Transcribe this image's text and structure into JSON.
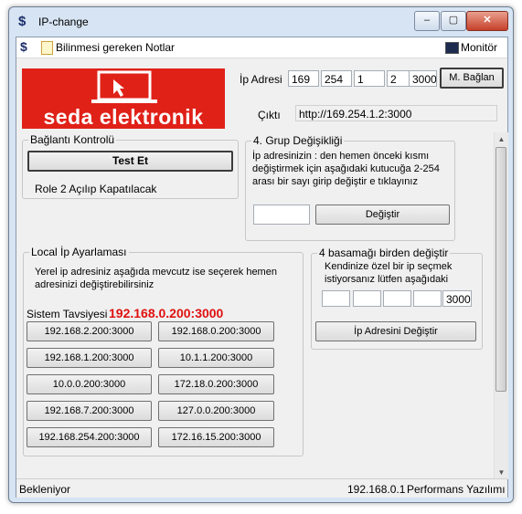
{
  "window": {
    "title": "IP-change"
  },
  "menu": {
    "notes": "Bilinmesi gereken Notlar",
    "monitor": "Monitör"
  },
  "logo": {
    "brand": "seda elektronik"
  },
  "ip": {
    "label": "İp Adresi",
    "octet1": "169",
    "octet2": "254",
    "octet3": "1",
    "octet4": "2",
    "port": "3000",
    "connect_button": "M. Bağlan",
    "output_label": "Çıktı",
    "output_value": "http://169.254.1.2:3000"
  },
  "connection_group": {
    "title": "Bağlantı Kontrolü",
    "test_button": "Test Et",
    "info": "Role 2 Açılıp Kapatılacak"
  },
  "group4": {
    "title": "4. Grup Değişikliği",
    "description": [
      "İp adresinizin : den hemen önceki kısmı",
      "değiştirmek için aşağıdaki kutucuğa 2-254",
      "arası bir sayı girip değiştir e tıklayınız"
    ],
    "input_value": "",
    "change_button": "Değiştir"
  },
  "local_ip": {
    "title": "Local İp Ayarlaması",
    "description": [
      "Yerel ip adresiniz aşağıda mevcutz ise seçerek hemen",
      "adresinizi değiştirebilirsiniz"
    ],
    "recommendation_label": "Sistem Tavsiyesi",
    "recommendation_value": "192.168.0.200:3000",
    "addresses": [
      "192.168.2.200:3000",
      "192.168.0.200:3000",
      "192.168.1.200:3000",
      "10.1.1.200:3000",
      "10.0.0.200:3000",
      "172.18.0.200:3000",
      "192.168.7.200:3000",
      "127.0.0.200:3000",
      "192.168.254.200:3000",
      "172.16.15.200:3000"
    ]
  },
  "all_octets": {
    "title": "4 basamağı birden değiştir",
    "description": [
      "Kendinize özel bir ip seçmek",
      "istiyorsanız lütfen aşağıdaki"
    ],
    "o1": "",
    "o2": "",
    "o3": "",
    "o4": "",
    "port": "3000",
    "change_button": "İp Adresini Değiştir"
  },
  "status": {
    "state": "Bekleniyor",
    "ip": "192.168.0.1",
    "company": "Performans Yazılımı"
  },
  "colors": {
    "brand_red": "#e02118",
    "recommendation_red": "#e01010"
  }
}
